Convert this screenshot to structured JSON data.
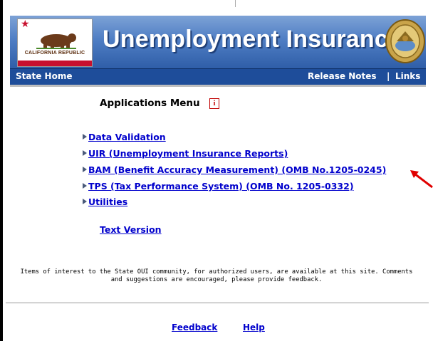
{
  "banner": {
    "title": "Unemployment Insurance",
    "flag_text": "CALIFORNIA REPUBLIC",
    "seal_icon": "california-state-seal",
    "bear_icon": "bear-icon"
  },
  "navbar": {
    "state_home": "State Home",
    "release_notes": "Release Notes",
    "separator": "|",
    "links": "Links"
  },
  "menu": {
    "title": "Applications Menu",
    "info_icon_label": "i",
    "items": [
      {
        "label": "Data Validation"
      },
      {
        "label": "UIR (Unemployment Insurance Reports)"
      },
      {
        "label": "BAM (Benefit Accuracy Measurement) (OMB No.1205-0245)"
      },
      {
        "label": "TPS (Tax Performance System) (OMB No. 1205-0332)"
      },
      {
        "label": "Utilities"
      }
    ],
    "text_version": "Text Version"
  },
  "note": {
    "line1": "Items of interest to the State OUI community, for authorized users, are available at this site. Comments",
    "line2": "and suggestions are encouraged, please provide feedback."
  },
  "footer": {
    "feedback": "Feedback",
    "help": "Help"
  },
  "colors": {
    "banner_blue": "#2f5ea8",
    "nav_blue": "#1e4d9a",
    "link_blue": "#0000cc",
    "arrow_red": "#e00000"
  }
}
